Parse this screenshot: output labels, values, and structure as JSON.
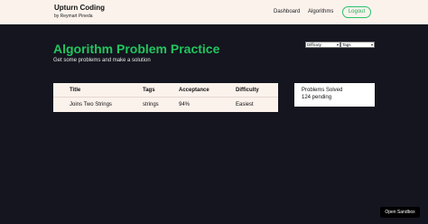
{
  "navbar": {
    "brand_title": "Upturn Coding",
    "brand_subtitle": "by Reymart Pineda",
    "links": [
      "Dashboard",
      "Algorithms"
    ],
    "logout_label": "Logout"
  },
  "page": {
    "title": "Algorithm Problem Practice",
    "subtitle": "Get some problems and make a solution"
  },
  "filters": {
    "difficulty": "Difficuty",
    "tags": "Tags"
  },
  "table": {
    "headers": [
      "Title",
      "Tags",
      "Acceptance",
      "Difficulty"
    ],
    "rows": [
      [
        "Joins Two Strings",
        "strings",
        "94%",
        "Easiest"
      ]
    ]
  },
  "stats": {
    "label": "Problems Solved",
    "pending": "124 pending"
  },
  "sandbox": {
    "label": "Open Sandbox"
  },
  "colors": {
    "accent_green": "#22c55e",
    "navbar_bg": "#fbf2ec",
    "page_bg": "#14151f"
  }
}
